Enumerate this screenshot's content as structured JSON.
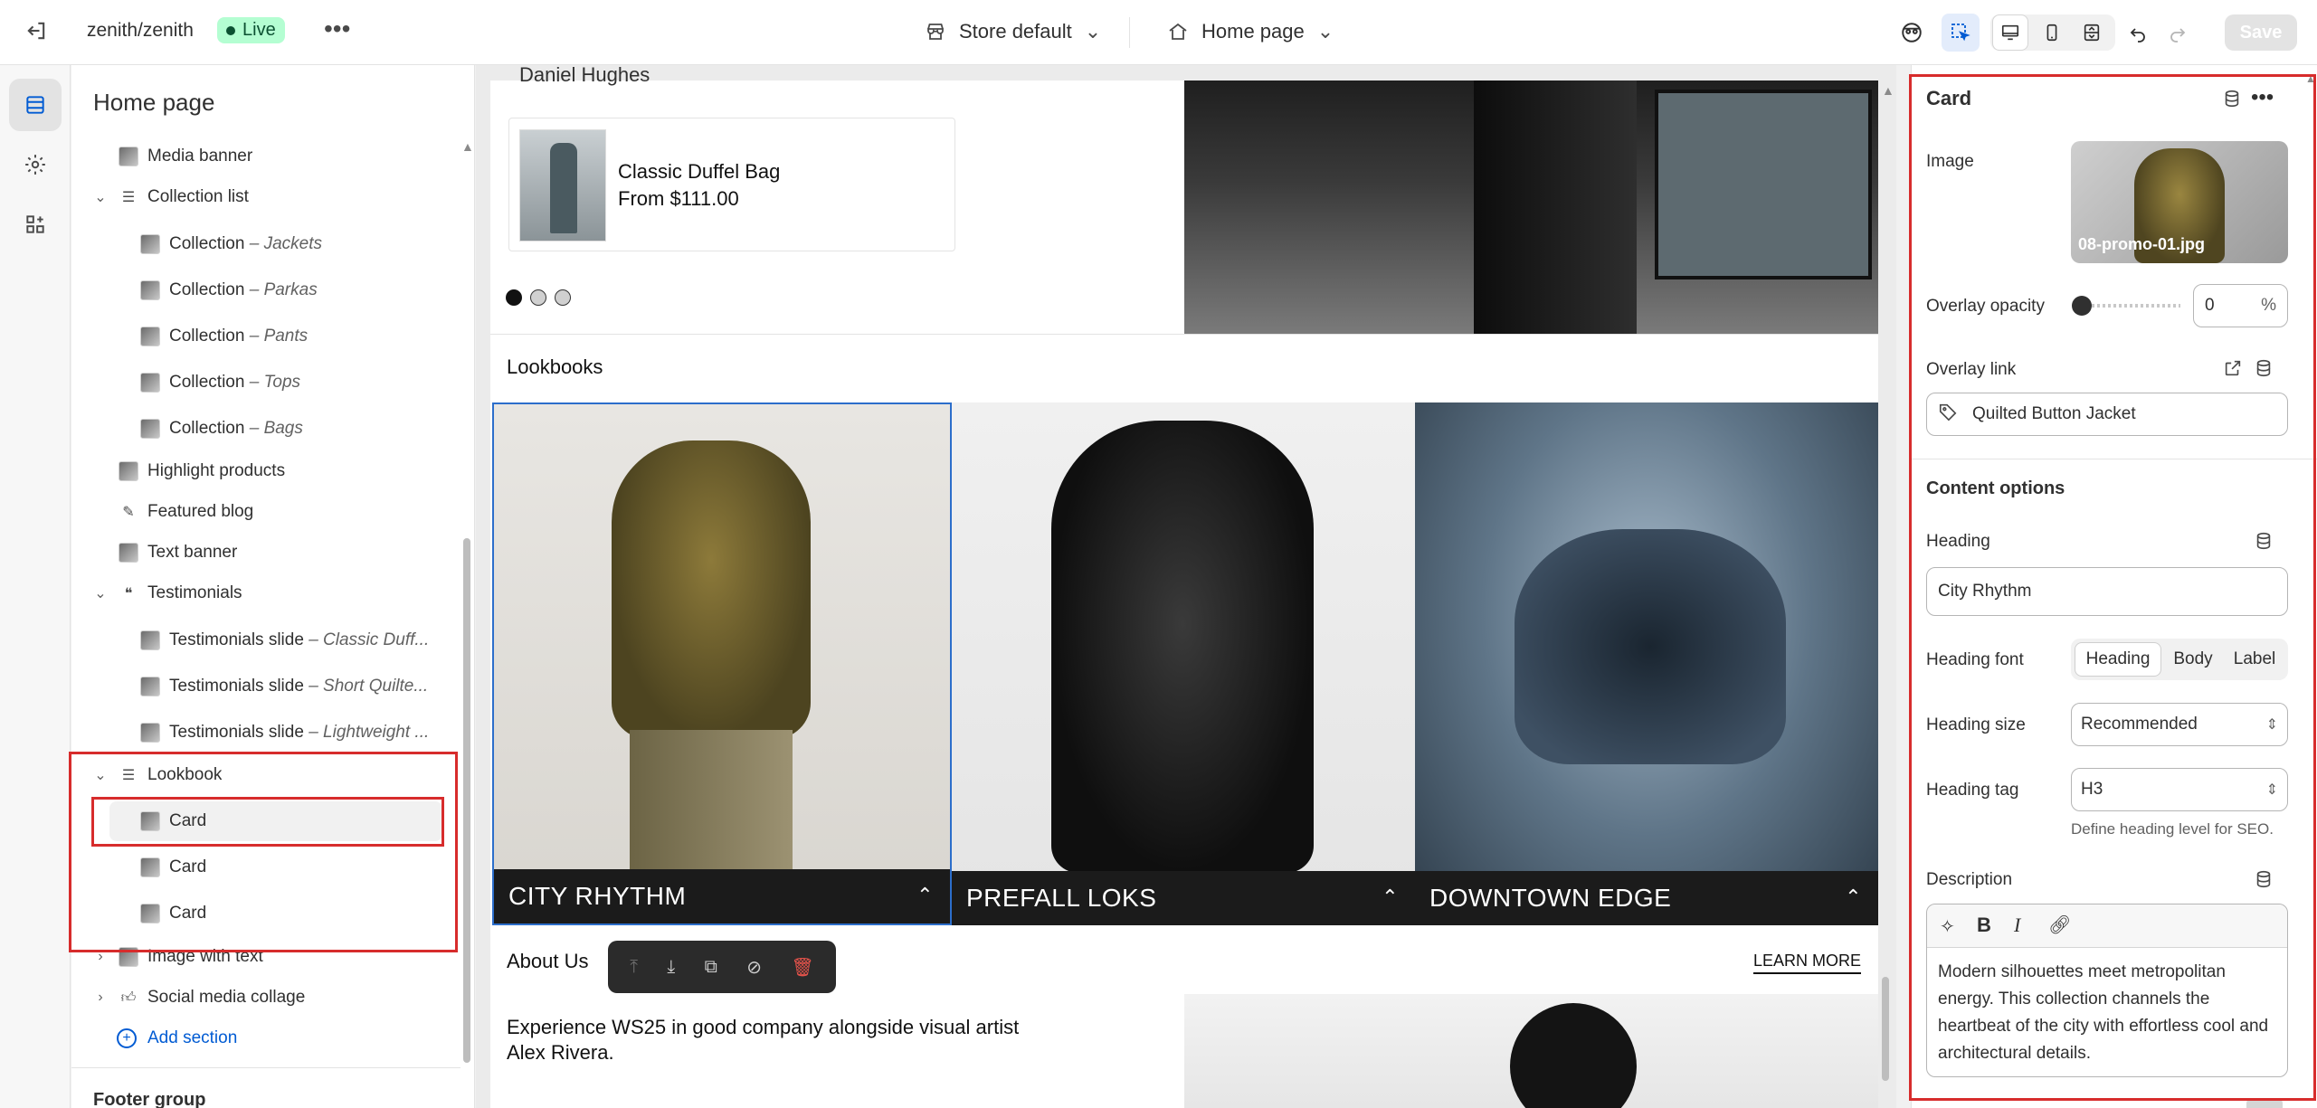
{
  "topbar": {
    "store_path": "zenith/zenith",
    "status": "Live",
    "theme_select": "Store default",
    "page_select": "Home page",
    "save_label": "Save"
  },
  "sidebar": {
    "title": "Home page",
    "items": [
      {
        "label": "Media banner"
      },
      {
        "label": "Collection list"
      },
      {
        "label": "Collection",
        "sub": "– Jackets"
      },
      {
        "label": "Collection",
        "sub": "– Parkas"
      },
      {
        "label": "Collection",
        "sub": "– Pants"
      },
      {
        "label": "Collection",
        "sub": "– Tops"
      },
      {
        "label": "Collection",
        "sub": "– Bags"
      },
      {
        "label": "Highlight products"
      },
      {
        "label": "Featured blog"
      },
      {
        "label": "Text banner"
      },
      {
        "label": "Testimonials"
      },
      {
        "label": "Testimonials slide",
        "sub": "– Classic Duff..."
      },
      {
        "label": "Testimonials slide",
        "sub": "– Short Quilte..."
      },
      {
        "label": "Testimonials slide",
        "sub": "– Lightweight ..."
      },
      {
        "label": "Lookbook"
      },
      {
        "label": "Card"
      },
      {
        "label": "Card"
      },
      {
        "label": "Card"
      },
      {
        "label": "Image with text"
      },
      {
        "label": "Social media collage"
      }
    ],
    "add_section": "Add section",
    "footer_group": "Footer group"
  },
  "preview": {
    "author_fragment": "Daniel Hughes",
    "product_name": "Classic Duffel Bag",
    "product_price": "From $111.00",
    "lookbooks_heading": "Lookbooks",
    "cards": [
      {
        "title": "CITY RHYTHM"
      },
      {
        "title": "PREFALL LOKS"
      },
      {
        "title": "DOWNTOWN EDGE"
      }
    ],
    "about_heading": "About Us",
    "learn_more": "LEARN MORE",
    "about_text": "Experience WS25 in good company alongside visual artist Alex Rivera."
  },
  "panel": {
    "title": "Card",
    "image_label": "Image",
    "image_filename": "08-promo-01.jpg",
    "overlay_opacity_label": "Overlay opacity",
    "overlay_opacity_value": "0",
    "overlay_opacity_unit": "%",
    "overlay_opacity_fraction": 0,
    "overlay_link_label": "Overlay link",
    "overlay_link_value": "Quilted Button Jacket",
    "content_options": "Content options",
    "heading_label": "Heading",
    "heading_value": "City Rhythm",
    "heading_font_label": "Heading font",
    "heading_font_options": [
      "Heading",
      "Body",
      "Label"
    ],
    "heading_font_selected": "Heading",
    "heading_size_label": "Heading size",
    "heading_size_value": "Recommended",
    "heading_tag_label": "Heading tag",
    "heading_tag_value": "H3",
    "heading_tag_hint": "Define heading level for SEO.",
    "description_label": "Description",
    "description_text": "Modern silhouettes meet metropolitan energy. This collection channels the heartbeat of the city with effortless cool and architectural details."
  },
  "colors": {
    "accent_blue": "#005bd3",
    "highlight_red": "#d72c2c",
    "live_bg": "#b4fed2",
    "live_text": "#0c5132"
  },
  "icons": [
    "exit-icon",
    "more-icon",
    "store-icon",
    "home-icon",
    "chevron-down-icon",
    "eye-icon",
    "inspector-icon",
    "desktop-icon",
    "mobile-icon",
    "fullwidth-icon",
    "undo-icon",
    "redo-icon",
    "sections-icon",
    "settings-icon",
    "apps-icon",
    "database-icon",
    "link-out-icon",
    "tag-icon",
    "bold-icon",
    "italic-icon",
    "link-icon",
    "ai-icon"
  ]
}
